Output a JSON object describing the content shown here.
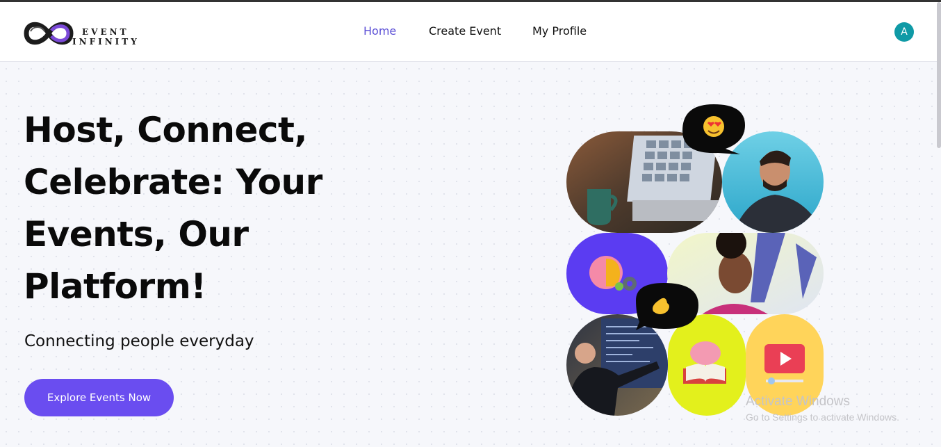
{
  "header": {
    "logo": {
      "line1": "EVENT",
      "line2": "INFINITY"
    },
    "nav": [
      {
        "label": "Home",
        "active": true
      },
      {
        "label": "Create Event",
        "active": false
      },
      {
        "label": "My Profile",
        "active": false
      }
    ],
    "avatar_initial": "A"
  },
  "hero": {
    "title": "Host, Connect, Celebrate: Your Events, Our Platform!",
    "subtitle": "Connecting people everyday",
    "cta_label": "Explore Events Now"
  },
  "collage": {
    "tiles": [
      {
        "name": "laptop-video-call-photo"
      },
      {
        "name": "laughing-man-photo"
      },
      {
        "name": "brain-lightbulb-icon"
      },
      {
        "name": "smiling-woman-photo"
      },
      {
        "name": "presenter-photo"
      },
      {
        "name": "brain-book-icon"
      },
      {
        "name": "video-play-icon"
      }
    ],
    "bubbles": [
      {
        "name": "heart-eyes-emoji-bubble"
      },
      {
        "name": "hand-emoji-bubble"
      }
    ]
  },
  "os_watermark": {
    "title": "Activate Windows",
    "text": "Go to Settings to activate Windows."
  },
  "colors": {
    "accent": "#6a4df0",
    "nav_active": "#5b4fd6",
    "avatar": "#0f9aa6",
    "background": "#f6f7fb"
  }
}
